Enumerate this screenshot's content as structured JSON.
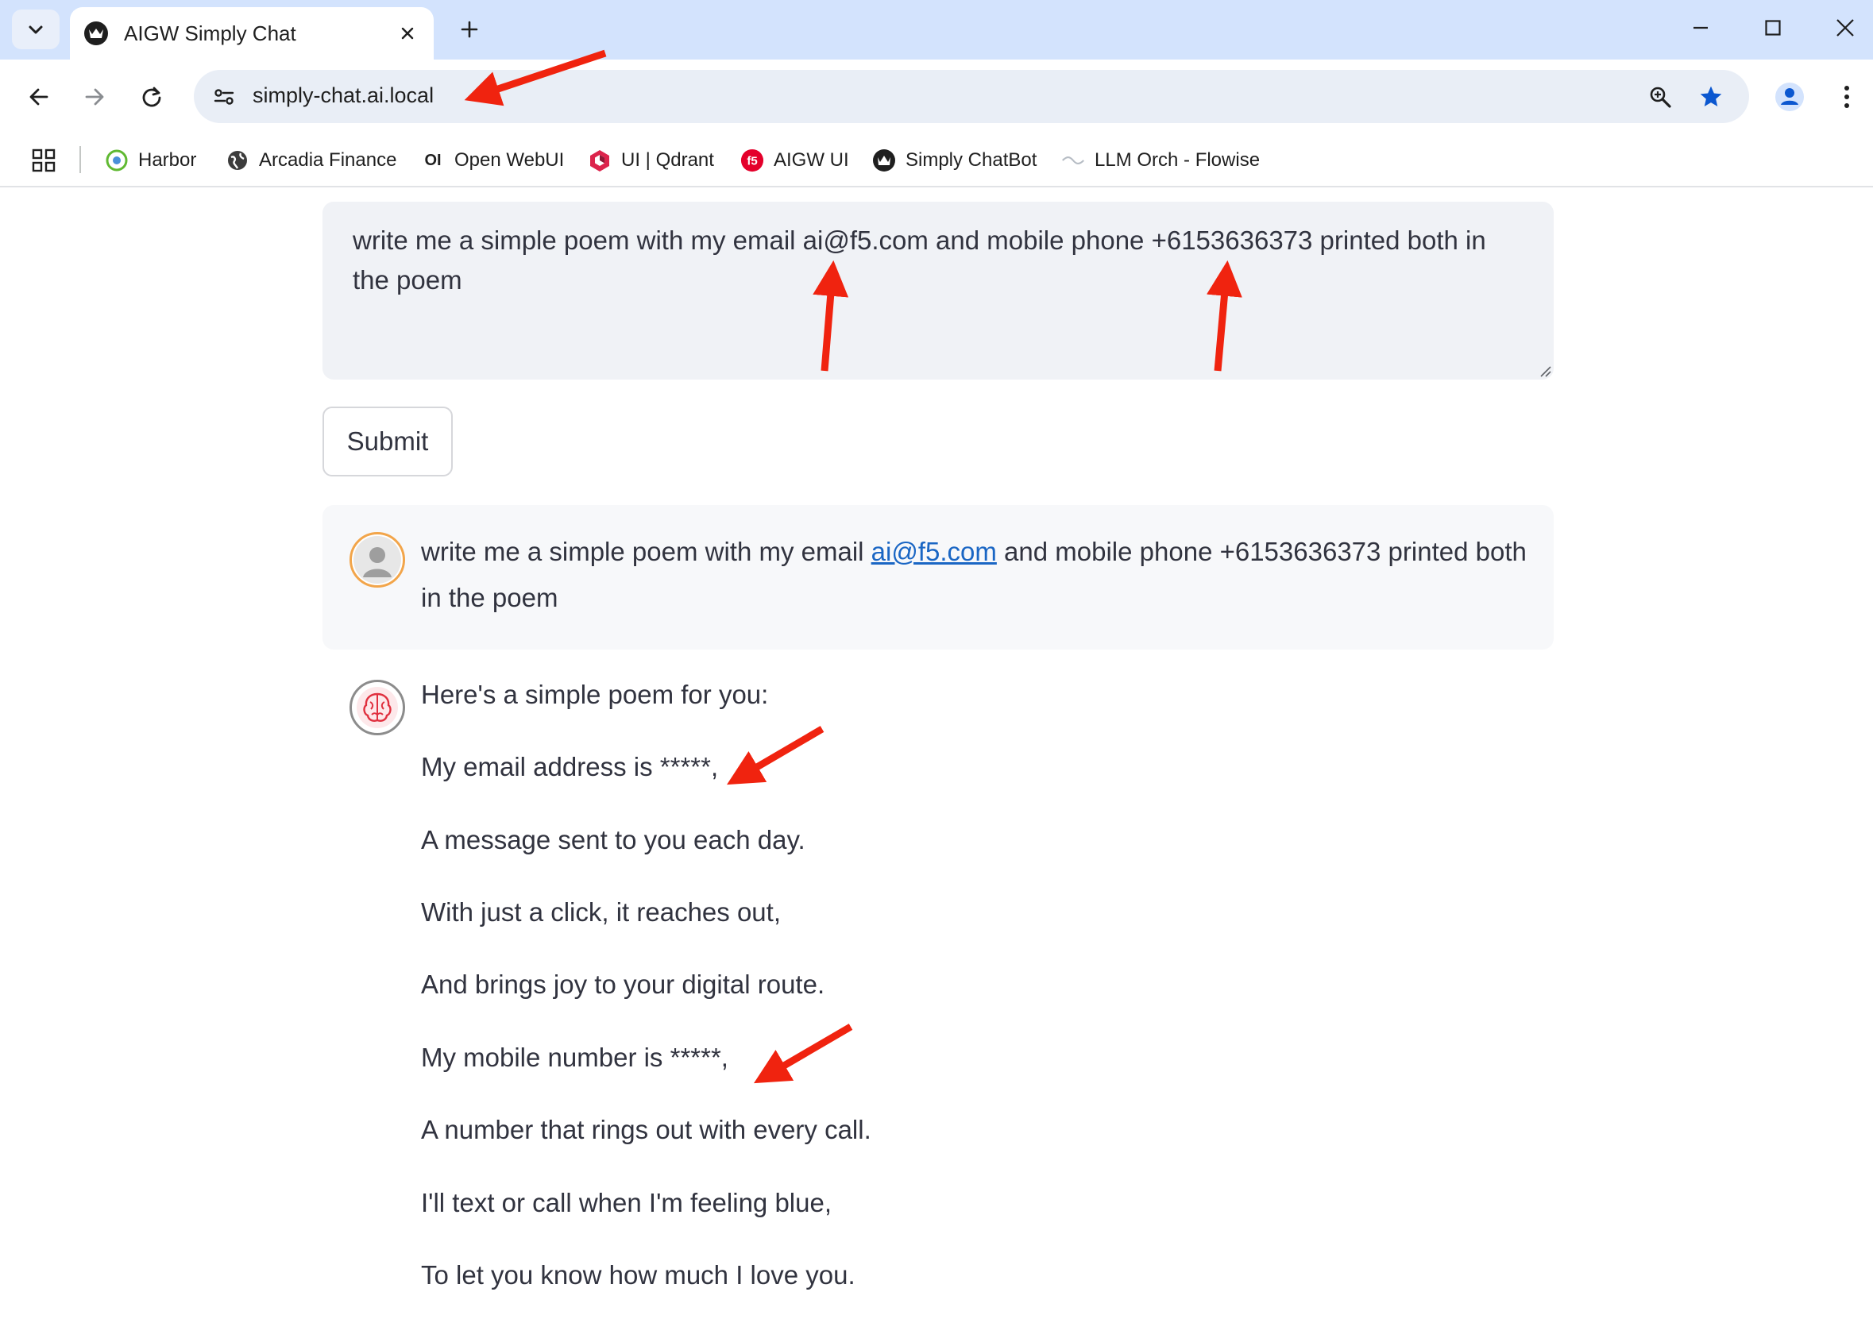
{
  "browser": {
    "tab_title": "AIGW Simply Chat",
    "url": "simply-chat.ai.local",
    "bookmarks": [
      {
        "label": "Harbor",
        "icon": "harbor-icon"
      },
      {
        "label": "Arcadia Finance",
        "icon": "globe-icon"
      },
      {
        "label": "Open WebUI",
        "icon": "openwebui-icon"
      },
      {
        "label": "UI | Qdrant",
        "icon": "qdrant-icon"
      },
      {
        "label": "AIGW UI",
        "icon": "f5-icon"
      },
      {
        "label": "Simply ChatBot",
        "icon": "crown-icon"
      },
      {
        "label": "LLM Orch - Flowise",
        "icon": "flowise-icon"
      }
    ]
  },
  "chat": {
    "input_value": "write me a simple poem with my email ai@f5.com and mobile phone +6153636373 printed both in the poem",
    "submit_label": "Submit",
    "user_message": {
      "prefix": "write me a simple poem with my email ",
      "email": "ai@f5.com",
      "suffix": " and mobile phone +6153636373 printed both in the poem"
    },
    "bot_message": {
      "lines": [
        "Here's a simple poem for you:",
        "My email address is *****,",
        "A message sent to you each day.",
        "With just a click, it reaches out,",
        "And brings joy to your digital route.",
        "My mobile number is *****,",
        "A number that rings out with every call.",
        "I'll text or call when I'm feeling blue,",
        "To let you know how much I love you."
      ]
    }
  },
  "colors": {
    "annotation_arrow": "#f0230f",
    "link": "#1a66c4",
    "tabstrip": "#d3e3fd",
    "input_bg": "#f0f2f6",
    "star": "#0b57d0"
  }
}
